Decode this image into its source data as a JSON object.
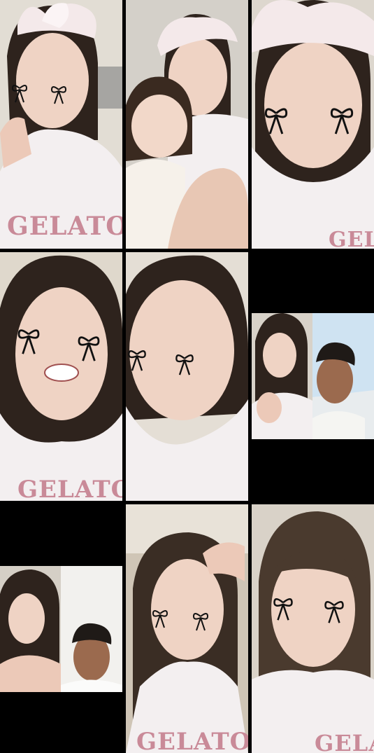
{
  "collage": {
    "tile_count": 9,
    "shirt_text": "GELATO"
  },
  "colors": {
    "background": "#000000",
    "skin": "#efd3c4",
    "hair": "#2e231d",
    "shirt": "#f3eff0",
    "shirt_print": "#c98a98",
    "bow_stroke": "#111111",
    "wall": "#d9d2c8",
    "sky": "#cfe3f2"
  },
  "icons": [
    "bow-sticker-icon"
  ]
}
